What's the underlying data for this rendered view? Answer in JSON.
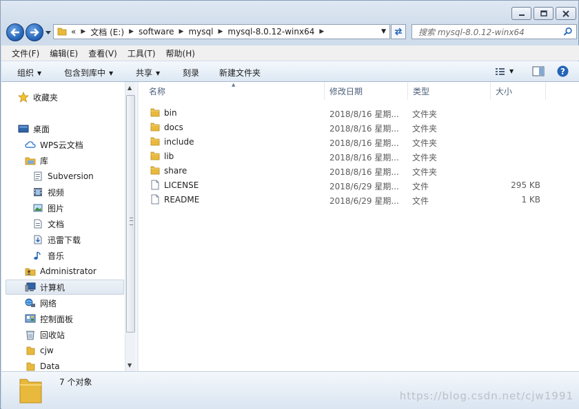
{
  "window": {
    "controls": {
      "minimize": "minimize-icon",
      "maximize": "maximize-icon",
      "close": "close-icon"
    }
  },
  "address": {
    "prefix": "«",
    "crumbs": [
      "文档 (E:)",
      "software",
      "mysql",
      "mysql-8.0.12-winx64"
    ]
  },
  "search": {
    "placeholder": "搜索 mysql-8.0.12-winx64"
  },
  "menu": [
    "文件(F)",
    "编辑(E)",
    "查看(V)",
    "工具(T)",
    "帮助(H)"
  ],
  "toolbar": {
    "organize": "组织",
    "include_library": "包含到库中",
    "share": "共享",
    "burn": "刻录",
    "new_folder": "新建文件夹"
  },
  "nav": {
    "favorites": "收藏夹",
    "desktop": "桌面",
    "wps": "WPS云文档",
    "library": "库",
    "subversion": "Subversion",
    "video": "视频",
    "pictures": "图片",
    "documents": "文档",
    "xunlei": "迅雷下载",
    "music": "音乐",
    "administrator": "Administrator",
    "computer": "计算机",
    "network": "网络",
    "control_panel": "控制面板",
    "recycle": "回收站",
    "cjw": "cjw",
    "data": "Data"
  },
  "columns": {
    "name": "名称",
    "date": "修改日期",
    "type": "类型",
    "size": "大小"
  },
  "files": [
    {
      "name": "bin",
      "date": "2018/8/16 星期...",
      "type": "文件夹",
      "size": "",
      "icon": "folder-icon"
    },
    {
      "name": "docs",
      "date": "2018/8/16 星期...",
      "type": "文件夹",
      "size": "",
      "icon": "folder-icon"
    },
    {
      "name": "include",
      "date": "2018/8/16 星期...",
      "type": "文件夹",
      "size": "",
      "icon": "folder-icon"
    },
    {
      "name": "lib",
      "date": "2018/8/16 星期...",
      "type": "文件夹",
      "size": "",
      "icon": "folder-icon"
    },
    {
      "name": "share",
      "date": "2018/8/16 星期...",
      "type": "文件夹",
      "size": "",
      "icon": "folder-icon"
    },
    {
      "name": "LICENSE",
      "date": "2018/6/29 星期...",
      "type": "文件",
      "size": "295 KB",
      "icon": "file-icon"
    },
    {
      "name": "README",
      "date": "2018/6/29 星期...",
      "type": "文件",
      "size": "1 KB",
      "icon": "file-icon"
    }
  ],
  "status": {
    "count": "7 个对象"
  },
  "watermark": "https://blog.csdn.net/cjw1991",
  "colors": {
    "folder": "#e8b93c",
    "accent": "#2364b8",
    "selection": "#dfe7f1"
  }
}
